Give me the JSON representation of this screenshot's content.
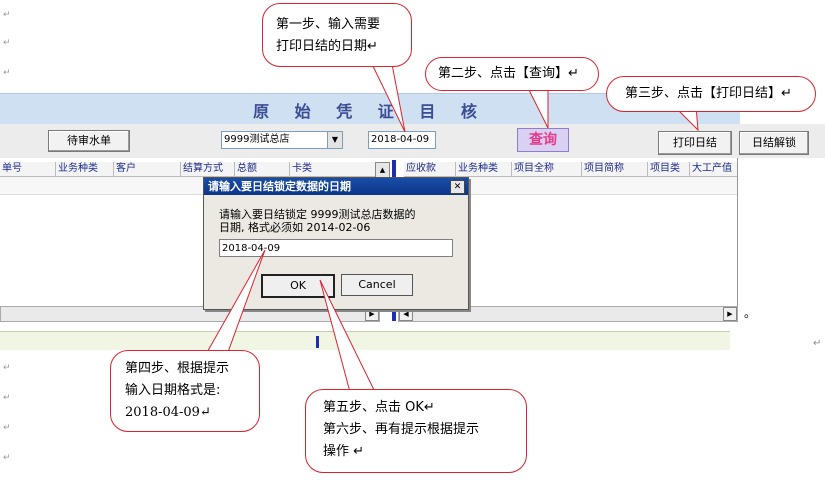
{
  "margin_marks": [
    "↵",
    "↵",
    "↵",
    "↵",
    "↵",
    "↵",
    "↵"
  ],
  "app": {
    "title": "原 始 凭 证 目 核",
    "buttons": {
      "pending": "待审水单",
      "query": "查询",
      "print_daily": "打印日结",
      "daily_unlock": "日结解锁"
    },
    "store_select": "9999测试总店",
    "date_field": "2018-04-09",
    "columns_left": [
      "单号",
      "业务种类",
      "客户",
      "结算方式",
      "总额",
      "卡类"
    ],
    "columns_right": [
      "应收款",
      "业务种类",
      "项目全称",
      "项目简称",
      "项目类",
      "大工产值"
    ],
    "side_dot": "。"
  },
  "dialog": {
    "title": "请输入要日结锁定数据的日期",
    "message_line1": "请输入要日结锁定 9999测试总店数据的",
    "message_line2": "日期, 格式必须如 2014-02-06",
    "input_value": "2018-04-09",
    "ok": "OK",
    "cancel": "Cancel",
    "close": "✕"
  },
  "callouts": {
    "step1_line1": "第一步、输入需要",
    "step1_line2": "打印日结的日期↵",
    "step2": "第二步、点击【查询】↵",
    "step3": "第三步、点击【打印日结】↵",
    "step4_line1": "第四步、根据提示",
    "step4_line2": "输入日期格式是:",
    "step4_line3": "2018-04-09↵",
    "step5_line1": "第五步、点击 OK↵",
    "step5_line2": "第六步、再有提示根据提示",
    "step5_line3": "操作 ↵"
  },
  "colors": {
    "callout_border": "#d9232f",
    "title_bar": "#cfe0f3",
    "dialog_title": "#1a4ea6",
    "query_text": "#e63a8c"
  }
}
